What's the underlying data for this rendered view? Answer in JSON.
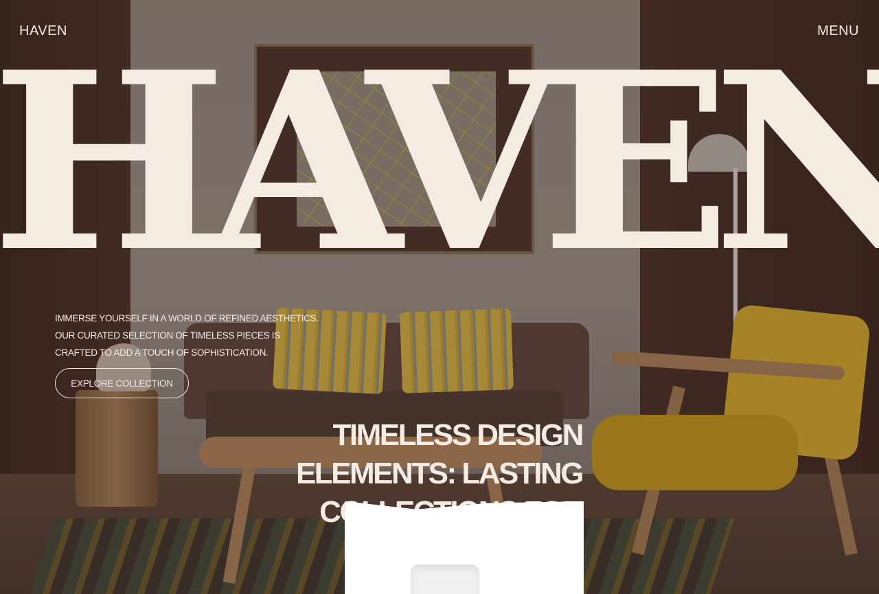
{
  "nav": {
    "brand": "HAVEN",
    "menu_label": "MENU"
  },
  "hero": {
    "wordmark": "HAVEN",
    "tagline_lines": [
      "IMMERSE YOURSELF IN A WORLD OF REFINED AESTHETICS.",
      "OUR CURATED SELECTION OF TIMELESS PIECES IS",
      "CRAFTED TO ADD A TOUCH OF SOPHISTICATION."
    ],
    "cta_label": "EXPLORE COLLECTION",
    "headline_lines": [
      "TIMELESS DESIGN",
      "ELEMENTS: LASTING",
      "COLLECTIONS FOR"
    ]
  },
  "colors": {
    "text": "#f4ece4",
    "card": "#ffffff"
  }
}
